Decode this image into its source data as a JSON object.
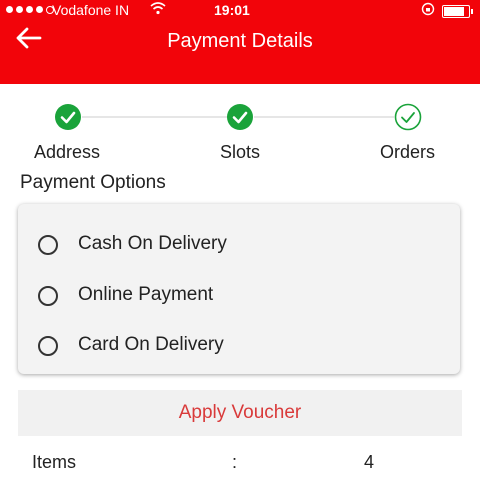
{
  "status_bar": {
    "carrier": "Vodafone IN",
    "time": "19:01",
    "icons": [
      "signal-dots-icon",
      "wifi-icon",
      "rotation-lock-icon",
      "battery-icon"
    ]
  },
  "header": {
    "title": "Payment Details",
    "back_icon": "back-arrow-icon"
  },
  "steps": [
    {
      "label": "Address",
      "state": "completed"
    },
    {
      "label": "Slots",
      "state": "completed"
    },
    {
      "label": "Orders",
      "state": "current"
    }
  ],
  "payment": {
    "title": "Payment Options",
    "options": [
      {
        "label": "Cash On Delivery",
        "selected": false
      },
      {
        "label": "Online Payment",
        "selected": false
      },
      {
        "label": "Card On Delivery",
        "selected": false
      }
    ]
  },
  "voucher": {
    "label": "Apply Voucher"
  },
  "summary": {
    "items_label": "Items",
    "separator": ":",
    "items_value": "4"
  },
  "colors": {
    "primary": "#f2040a",
    "step_done": "#1aa33a",
    "voucher_text": "#d93a3a",
    "card_bg": "#f3f3f3"
  }
}
